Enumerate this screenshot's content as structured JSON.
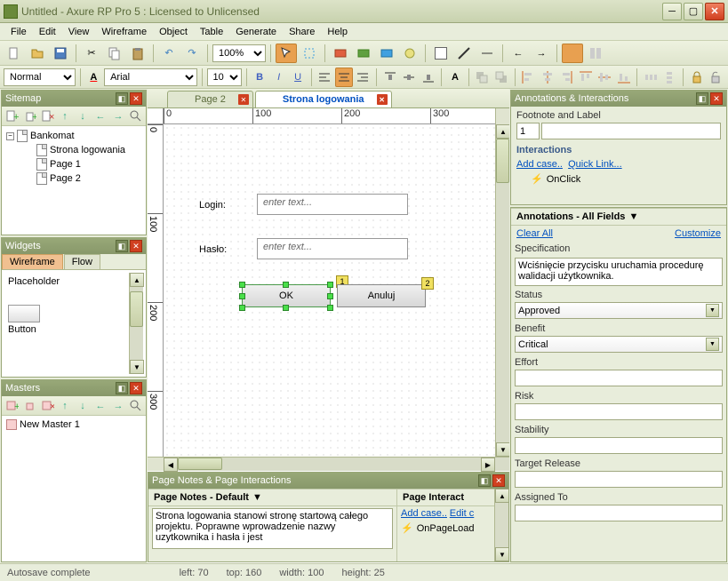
{
  "window": {
    "title": "Untitled - Axure RP Pro 5 : Licensed to Unlicensed"
  },
  "menu": {
    "file": "File",
    "edit": "Edit",
    "view": "View",
    "wireframe": "Wireframe",
    "object": "Object",
    "table": "Table",
    "generate": "Generate",
    "share": "Share",
    "help": "Help"
  },
  "toolbar": {
    "zoom": "100%"
  },
  "format": {
    "style": "Normal",
    "font": "Arial",
    "size": "10"
  },
  "sitemap": {
    "title": "Sitemap",
    "root": "Bankomat",
    "items": [
      "Strona logowania",
      "Page 1",
      "Page 2"
    ]
  },
  "widgets": {
    "title": "Widgets",
    "tabs": {
      "wireframe": "Wireframe",
      "flow": "Flow"
    },
    "items": {
      "placeholder": "Placeholder",
      "button": "Button"
    }
  },
  "masters": {
    "title": "Masters",
    "items": [
      "New Master 1"
    ]
  },
  "tabs": {
    "page2": "Page 2",
    "active": "Strona logowania"
  },
  "canvas": {
    "login_label": "Login:",
    "haslo_label": "Hasło:",
    "placeholder": "enter text...",
    "ok": "OK",
    "anuluj": "Anuluj",
    "annot_num": "1",
    "badge": "2"
  },
  "annotations": {
    "panel_title": "Annotations & Interactions",
    "footnote_label": "Footnote and Label",
    "footnote_value": "1",
    "interactions_title": "Interactions",
    "add_case": "Add case..",
    "quick_link": "Quick Link...",
    "onclick": "OnClick",
    "all_fields": "Annotations - All Fields",
    "clear_all": "Clear All",
    "customize": "Customize",
    "spec_label": "Specification",
    "spec_text": "Wciśnięcie przycisku uruchamia procedurę walidacji użytkownika.",
    "status_label": "Status",
    "status_value": "Approved",
    "benefit_label": "Benefit",
    "benefit_value": "Critical",
    "effort_label": "Effort",
    "risk_label": "Risk",
    "stability_label": "Stability",
    "target_label": "Target Release",
    "assigned_label": "Assigned To"
  },
  "pagenotes": {
    "panel_title": "Page Notes & Page Interactions",
    "notes_title": "Page Notes - Default",
    "interact_title": "Page Interact",
    "add_case": "Add case..",
    "edit": "Edit c",
    "onpageload": "OnPageLoad",
    "text": "Strona logowania stanowi stronę startową całego projektu. Poprawne wprowadzenie nazwy uzytkownika i hasła i jest"
  },
  "status": {
    "autosave": "Autosave complete",
    "left": "left: 70",
    "top": "top: 160",
    "width": "width: 100",
    "height": "height: 25"
  },
  "ruler": {
    "m0": "0",
    "m100": "100",
    "m200": "200",
    "m300": "300"
  }
}
